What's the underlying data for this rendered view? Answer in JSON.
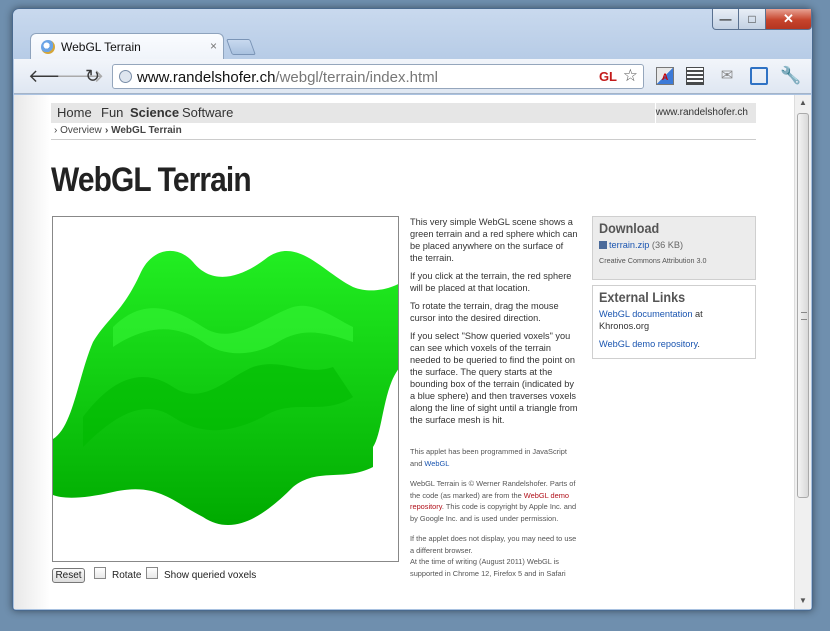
{
  "browser": {
    "tab_title": "WebGL Terrain",
    "tab_close": "×",
    "url_host": "www.randelshofer.ch",
    "url_path": "/webgl/terrain/index.html",
    "gl_badge": "GL",
    "window_controls": {
      "minimize": "—",
      "maximize": "□",
      "close": "✕"
    }
  },
  "site": {
    "nav": [
      "Home",
      "Fun",
      "Science",
      "Software"
    ],
    "nav_active": "Science",
    "site_name": "www.randelshofer.ch",
    "breadcrumb": [
      "› Overview",
      "› WebGL Terrain"
    ]
  },
  "page": {
    "title": "WebGL Terrain",
    "terrain_color": "#00cc00",
    "controls": {
      "reset": "Reset",
      "rotate": "Rotate",
      "rotate_checked": false,
      "show_voxels": "Show queried voxels",
      "show_voxels_checked": false
    },
    "description": [
      "This very simple WebGL scene shows a green terrain and a red sphere which can be placed anywhere on the surface of the terrain.",
      "If you click at the terrain, the red sphere will be placed at that location.",
      "To rotate the terrain, drag the mouse cursor into the desired direction.",
      "If you select \"Show queried voxels\" you can see which voxels of the terrain needed to be queried to find the point on the surface. The query starts at the bounding box of the terrain (indicated by a blue sphere) and then traverses voxels along the line of sight until a triangle from the surface mesh is hit."
    ],
    "note_js_prefix": "This applet has been programmed in JavaScript and",
    "note_js_link": "WebGL",
    "copyright_prefix": "WebGL Terrain is © Werner Randelshofer. Parts of the code (as marked) are from the",
    "copyright_link": "WebGL demo repository",
    "copyright_suffix": ". This code is copyright by Apple Inc. and by Google Inc. and is used under permission.",
    "display_note_1": "If the applet does not display, you may need to use a different browser.",
    "display_note_2": "At the time of writing (August 2011) WebGL is supported in Chrome 12, Firefox 5 and in Safari"
  },
  "sidebar": {
    "download": {
      "heading": "Download",
      "file_link": "terrain.zip",
      "file_size": " (36 KB)",
      "license": "Creative Commons Attribution 3.0"
    },
    "external": {
      "heading": "External Links",
      "link1": "WebGL documentation",
      "link1_suffix": " at Khronos.org",
      "link2": "WebGL demo repository",
      "link2_suffix": "."
    }
  }
}
